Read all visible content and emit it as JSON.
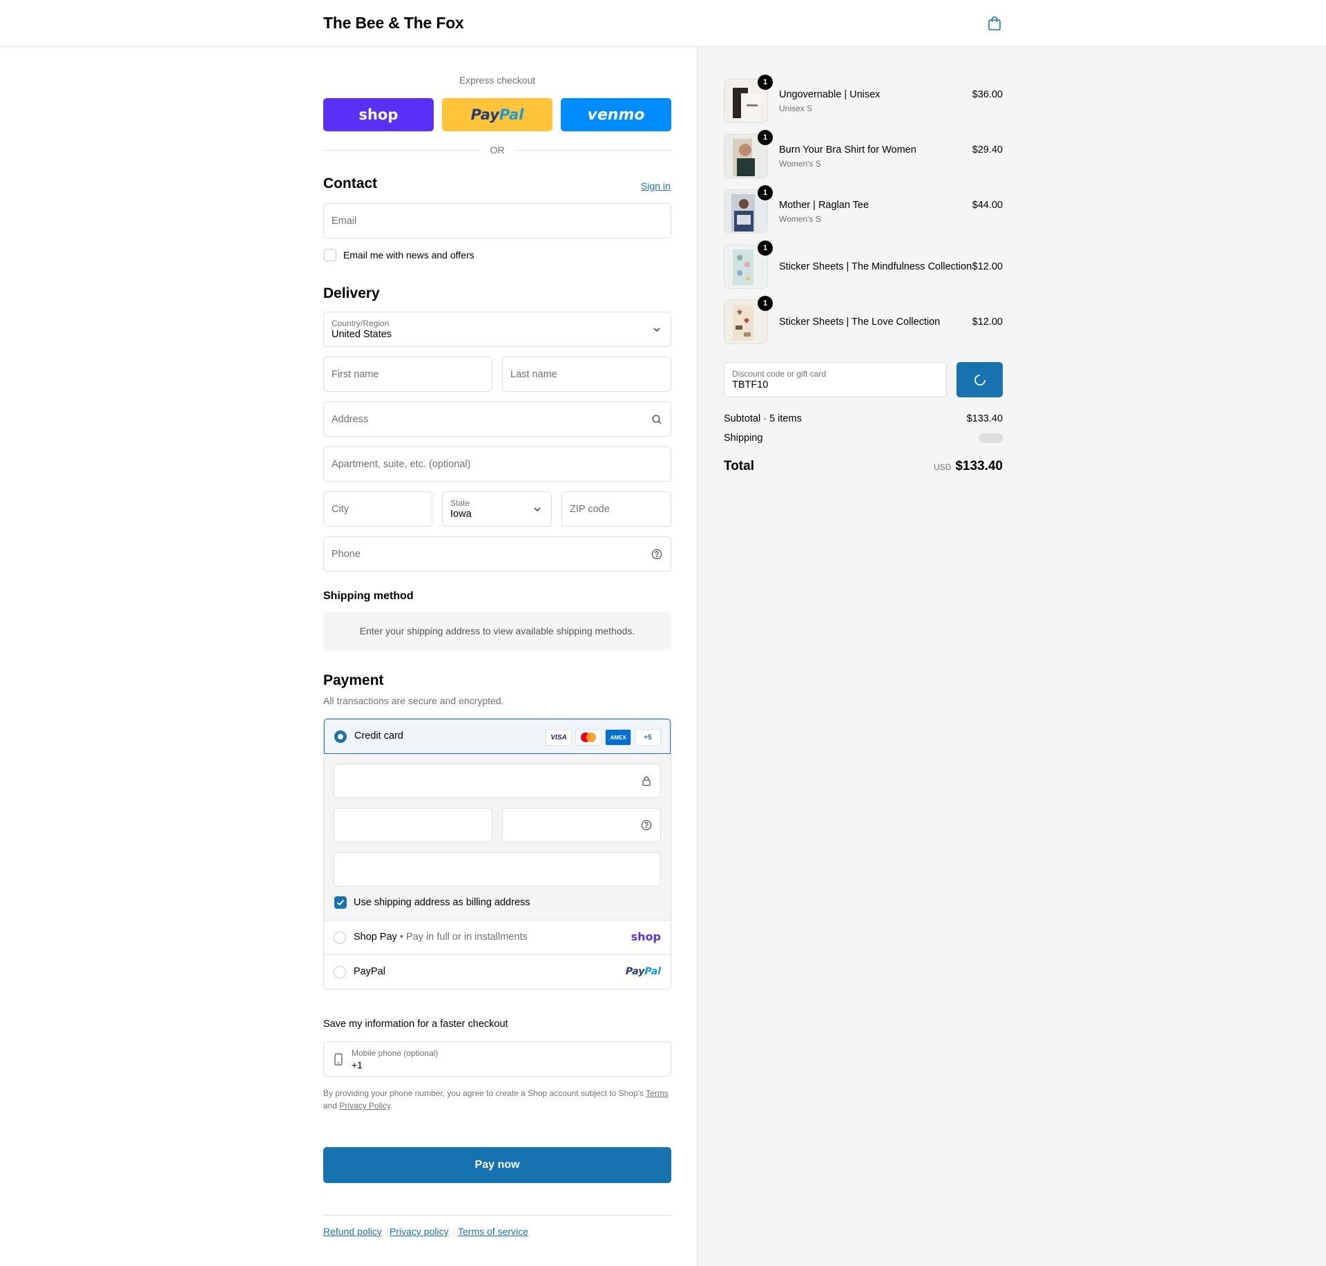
{
  "header": {
    "store_name": "The Bee & The Fox",
    "cart_icon": "shopping-bag-icon"
  },
  "express": {
    "label": "Express checkout",
    "shop_label": "shop",
    "paypal_label_1": "Pay",
    "paypal_label_2": "Pal",
    "venmo_label": "venmo",
    "or_label": "OR",
    "colors": {
      "shop": "#5a31f4",
      "paypal": "#ffc439",
      "venmo": "#008cff"
    }
  },
  "contact": {
    "title": "Contact",
    "sign_in": "Sign in",
    "email_placeholder": "Email",
    "news_label": "Email me with news and offers"
  },
  "delivery": {
    "title": "Delivery",
    "country_label": "Country/Region",
    "country_value": "United States",
    "first_name_placeholder": "First name",
    "last_name_placeholder": "Last name",
    "address_placeholder": "Address",
    "apartment_placeholder": "Apartment, suite, etc. (optional)",
    "city_placeholder": "City",
    "state_label": "State",
    "state_value": "Iowa",
    "zip_placeholder": "ZIP code",
    "phone_placeholder": "Phone"
  },
  "shipping_method": {
    "title": "Shipping method",
    "message": "Enter your shipping address to view available shipping methods."
  },
  "payment": {
    "title": "Payment",
    "subtitle": "All transactions are secure and encrypted.",
    "credit_card_label": "Credit card",
    "card_badges": [
      "VISA",
      "",
      "AMEX",
      "+5"
    ],
    "billing_label": "Use shipping address as billing address",
    "shop_pay_label": "Shop Pay",
    "shop_pay_sub": "Pay in full or in installments",
    "shop_pay_logo": "shop",
    "paypal_label": "PayPal",
    "paypal_logo_1": "Pay",
    "paypal_logo_2": "Pal"
  },
  "save_info": {
    "title": "Save my information for a faster checkout",
    "mobile_label": "Mobile phone (optional)",
    "mobile_value": "+1",
    "disclaimer_1": "By providing your phone number, you agree to create a Shop account subject to Shop's ",
    "terms": "Terms",
    "disclaimer_2": "and ",
    "privacy": "Privacy Policy",
    "disclaimer_3": "."
  },
  "pay_now": "Pay now",
  "footer": [
    "Refund policy",
    "Privacy policy",
    "Terms of service"
  ],
  "summary": {
    "items": [
      {
        "name": "Ungovernable | Unisex",
        "variant": "Unisex S",
        "price": "$36.00",
        "qty": "1"
      },
      {
        "name": "Burn Your Bra Shirt for Women",
        "variant": "Women's S",
        "price": "$29.40",
        "qty": "1"
      },
      {
        "name": "Mother | Raglan Tee",
        "variant": "Women's S",
        "price": "$44.00",
        "qty": "1"
      },
      {
        "name": "Sticker Sheets | The Mindfulness Collection",
        "variant": "",
        "price": "$12.00",
        "qty": "1"
      },
      {
        "name": "Sticker Sheets | The Love Collection",
        "variant": "",
        "price": "$12.00",
        "qty": "1"
      }
    ],
    "discount_label": "Discount code or gift card",
    "discount_value": "TBTF10",
    "subtotal_label": "Subtotal · 5 items",
    "subtotal_value": "$133.40",
    "shipping_label": "Shipping",
    "total_label": "Total",
    "currency": "USD",
    "total_value": "$133.40"
  },
  "accent_color": "#1773b0"
}
